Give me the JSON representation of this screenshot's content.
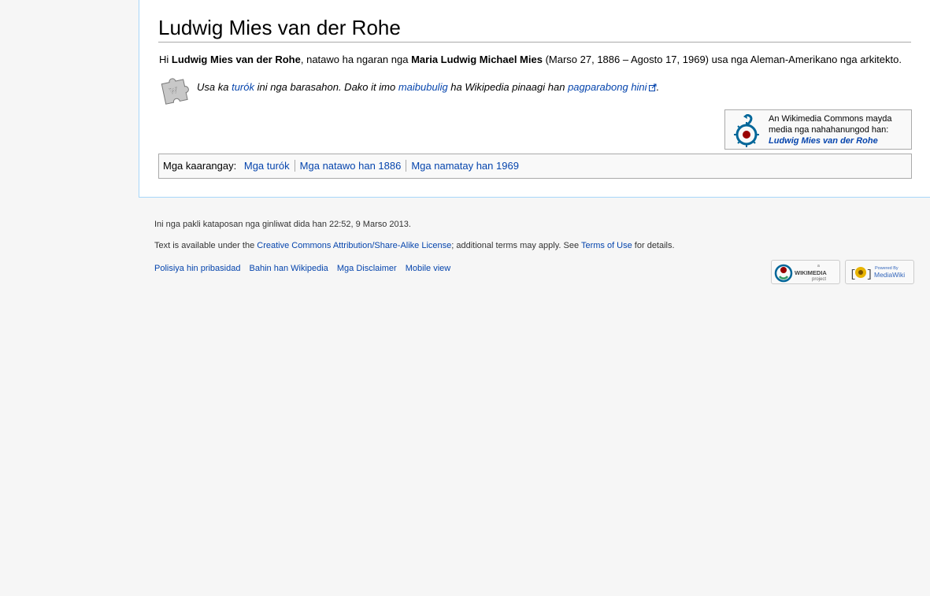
{
  "article": {
    "title": "Ludwig Mies van der Rohe",
    "lead": {
      "p1": "Hi ",
      "name_bold": "Ludwig Mies van der Rohe",
      "p2": ", natawo ha ngaran nga ",
      "birthname_bold": "Maria Ludwig Michael Mies",
      "p3": " (Marso 27, 1886 – Agosto 17, 1969) usa nga Aleman-Amerikano nga arkitekto."
    },
    "stub": {
      "t1": "Usa ka ",
      "link1": "turók",
      "t2": " ini nga barasahon. Dako it imo ",
      "link2": "maibubulig",
      "t3": " ha Wikipedia pinaagi han ",
      "link3": "pagparabong hini",
      "t4": "."
    },
    "commons": {
      "line1": "An Wikimedia Commons mayda",
      "line2": "media nga nahahanungod han:",
      "link": "Ludwig Mies van der Rohe"
    },
    "categories": {
      "label": "Mga kaarangay:",
      "items": [
        "Mga turók",
        "Mga natawo han 1886",
        "Mga namatay han 1969"
      ]
    }
  },
  "footer": {
    "lastmod": "Ini nga pakli kataposan nga ginliwat dida han 22:52, 9 Marso 2013.",
    "license": {
      "t1": "Text is available under the ",
      "link1": "Creative Commons Attribution/Share-Alike License",
      "t2": "; additional terms may apply. See ",
      "link2": "Terms of Use",
      "t3": " for details."
    },
    "places": [
      "Polisiya hin pribasidad",
      "Bahin han Wikipedia",
      "Mga Disclaimer",
      "Mobile view"
    ],
    "badges": {
      "wikimedia_small": "a",
      "wikimedia": "WIKIMEDIA",
      "wikimedia_sub": "project",
      "mediawiki_small": "Powered By",
      "mediawiki": "MediaWiki"
    }
  },
  "colors": {
    "link": "#0645ad",
    "content_border": "#a7d7f9",
    "background": "#f6f6f6"
  }
}
